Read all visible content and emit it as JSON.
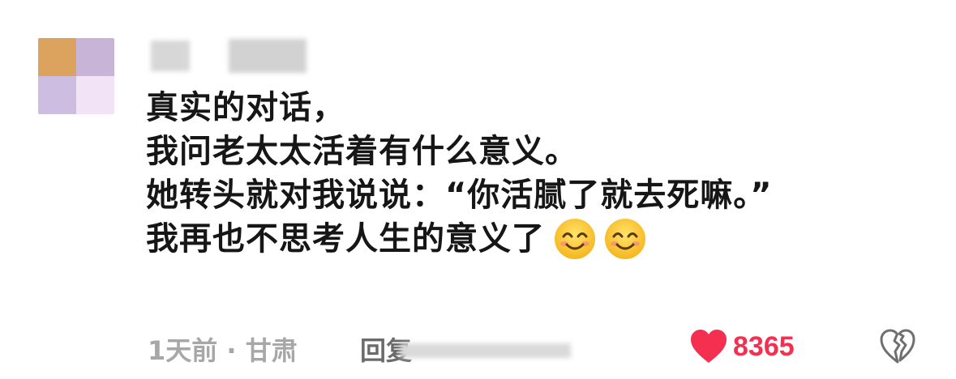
{
  "comment": {
    "lines": [
      "真实的对话，",
      "我问老太太活着有什么意义。",
      "她转头就对我说说：“你活腻了就去死嘛。”",
      "我再也不思考人生的意义了"
    ],
    "emojis": [
      "smiling-face-emoji",
      "smiling-face-emoji"
    ]
  },
  "footer": {
    "meta": "1天前 · 甘肃",
    "reply_label": "回复",
    "like_count": "8365",
    "like_color": "#f52f4f"
  }
}
